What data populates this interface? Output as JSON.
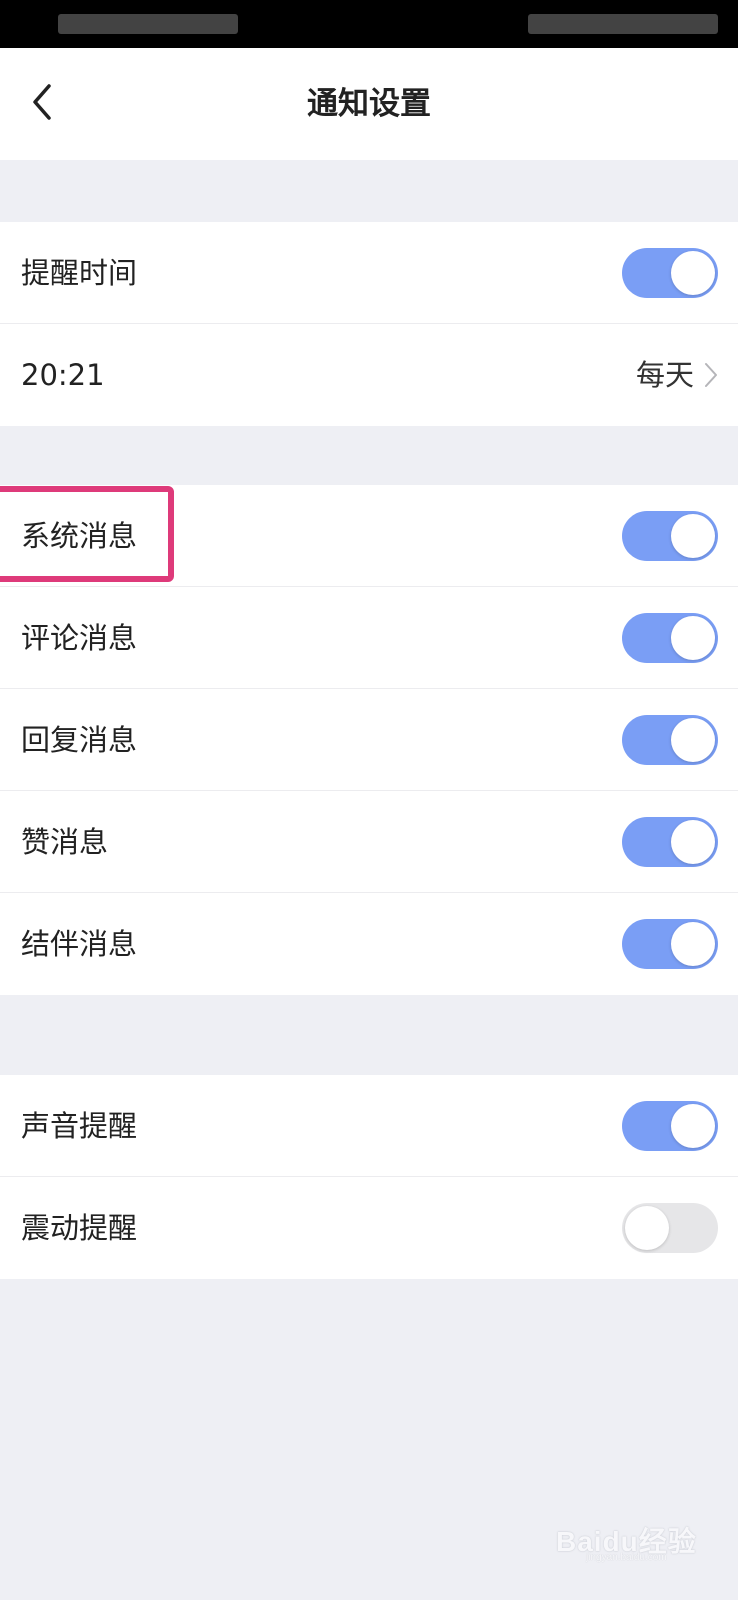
{
  "nav": {
    "title": "通知设置"
  },
  "reminder": {
    "label": "提醒时间",
    "enabled": true,
    "time": "20:21",
    "repeat": "每天"
  },
  "messages": [
    {
      "label": "系统消息",
      "enabled": true,
      "highlighted": true
    },
    {
      "label": "评论消息",
      "enabled": true
    },
    {
      "label": "回复消息",
      "enabled": true
    },
    {
      "label": "赞消息",
      "enabled": true
    },
    {
      "label": "结伴消息",
      "enabled": true
    }
  ],
  "alerts": [
    {
      "label": "声音提醒",
      "enabled": true
    },
    {
      "label": "震动提醒",
      "enabled": false
    }
  ],
  "watermark": {
    "text": "Baidu经验",
    "sub": "jingyan.baidu.com"
  },
  "colors": {
    "toggle_on": "#7a9ef5",
    "toggle_off": "#e6e6e8",
    "highlight": "#de3a7a",
    "background": "#eeeff4"
  }
}
